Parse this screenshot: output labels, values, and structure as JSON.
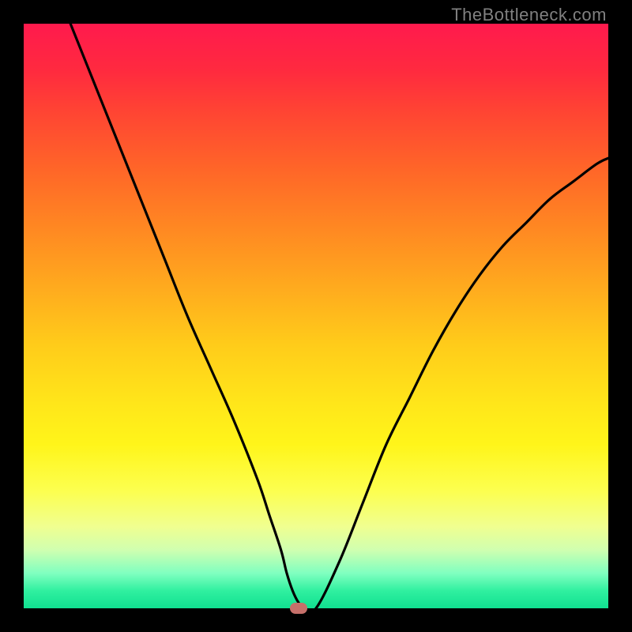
{
  "watermark": "TheBottleneck.com",
  "chart_data": {
    "type": "line",
    "title": "",
    "xlabel": "",
    "ylabel": "",
    "xlim": [
      0,
      100
    ],
    "ylim": [
      0,
      100
    ],
    "series": [
      {
        "name": "bottleneck-curve",
        "x": [
          8,
          12,
          16,
          20,
          24,
          28,
          32,
          36,
          40,
          42,
          44,
          45,
          46,
          47,
          48,
          50,
          54,
          58,
          62,
          66,
          70,
          74,
          78,
          82,
          86,
          90,
          94,
          98,
          100
        ],
        "y": [
          100,
          90,
          80,
          70,
          60,
          50,
          41,
          32,
          22,
          16,
          10,
          6,
          3,
          1,
          0,
          0,
          8,
          18,
          28,
          36,
          44,
          51,
          57,
          62,
          66,
          70,
          73,
          76,
          77
        ]
      }
    ],
    "marker": {
      "x": 47,
      "y": 0
    },
    "background_gradient": {
      "top": "#ff1a4d",
      "middle": "#ffe61a",
      "bottom": "#10e090"
    }
  }
}
